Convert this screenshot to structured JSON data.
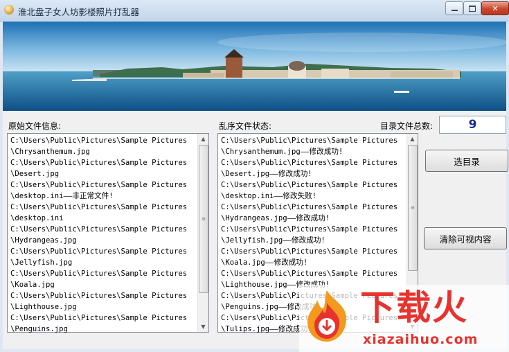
{
  "window": {
    "title": "淮北盘子女人坊影楼照片打乱器",
    "icons": {
      "app": "app-icon",
      "minimize": "minimize-icon",
      "maximize": "maximize-icon",
      "close": "close-icon"
    },
    "close_glyph": "✕"
  },
  "original_panel": {
    "label": "原始文件信息:",
    "lines": [
      "C:\\Users\\Public\\Pictures\\Sample Pictures",
      "\\Chrysanthemum.jpg",
      "C:\\Users\\Public\\Pictures\\Sample Pictures",
      "\\Desert.jpg",
      "C:\\Users\\Public\\Pictures\\Sample Pictures",
      "\\desktop.ini——非正常文件!",
      "C:\\Users\\Public\\Pictures\\Sample Pictures",
      "\\desktop.ini",
      "C:\\Users\\Public\\Pictures\\Sample Pictures",
      "\\Hydrangeas.jpg",
      "C:\\Users\\Public\\Pictures\\Sample Pictures",
      "\\Jellyfish.jpg",
      "C:\\Users\\Public\\Pictures\\Sample Pictures",
      "\\Koala.jpg",
      "C:\\Users\\Public\\Pictures\\Sample Pictures",
      "\\Lighthouse.jpg",
      "C:\\Users\\Public\\Pictures\\Sample Pictures",
      "\\Penguins.jpg"
    ]
  },
  "shuffled_panel": {
    "label": "乱序文件状态:",
    "lines": [
      "C:\\Users\\Public\\Pictures\\Sample Pictures",
      "\\Chrysanthemum.jpg——修改成功!",
      "C:\\Users\\Public\\Pictures\\Sample Pictures",
      "\\Desert.jpg——修改成功!",
      "C:\\Users\\Public\\Pictures\\Sample Pictures",
      "\\desktop.ini——修改失败!",
      "C:\\Users\\Public\\Pictures\\Sample Pictures",
      "\\Hydrangeas.jpg——修改成功!",
      "C:\\Users\\Public\\Pictures\\Sample Pictures",
      "\\Jellyfish.jpg——修改成功!",
      "C:\\Users\\Public\\Pictures\\Sample Pictures",
      "\\Koala.jpg——修改成功!",
      "C:\\Users\\Public\\Pictures\\Sample Pictures",
      "\\Lighthouse.jpg——修改成功!",
      "C:\\Users\\Public\\Pictures\\Sample Pictures",
      "\\Penguins.jpg——修改成功!",
      "C:\\Users\\Public\\Pictures\\Sample Pictures",
      "\\Tulips.jpg——修改成功!"
    ]
  },
  "file_count": {
    "label": "目录文件总数:",
    "value": "9"
  },
  "buttons": {
    "select_dir": "选目录",
    "clear": "清除可视内容"
  },
  "scrollbar": {
    "up_glyph": "▲",
    "down_glyph": "▼",
    "grip_glyph": "≡"
  },
  "watermark": {
    "brand": "下载火",
    "url": "xiazaihuo.com",
    "icon": "download-icon"
  },
  "colors": {
    "count_text": "#1a2a8c",
    "watermark_red": "#e8322e",
    "watermark_orange": "#f39a1e"
  }
}
